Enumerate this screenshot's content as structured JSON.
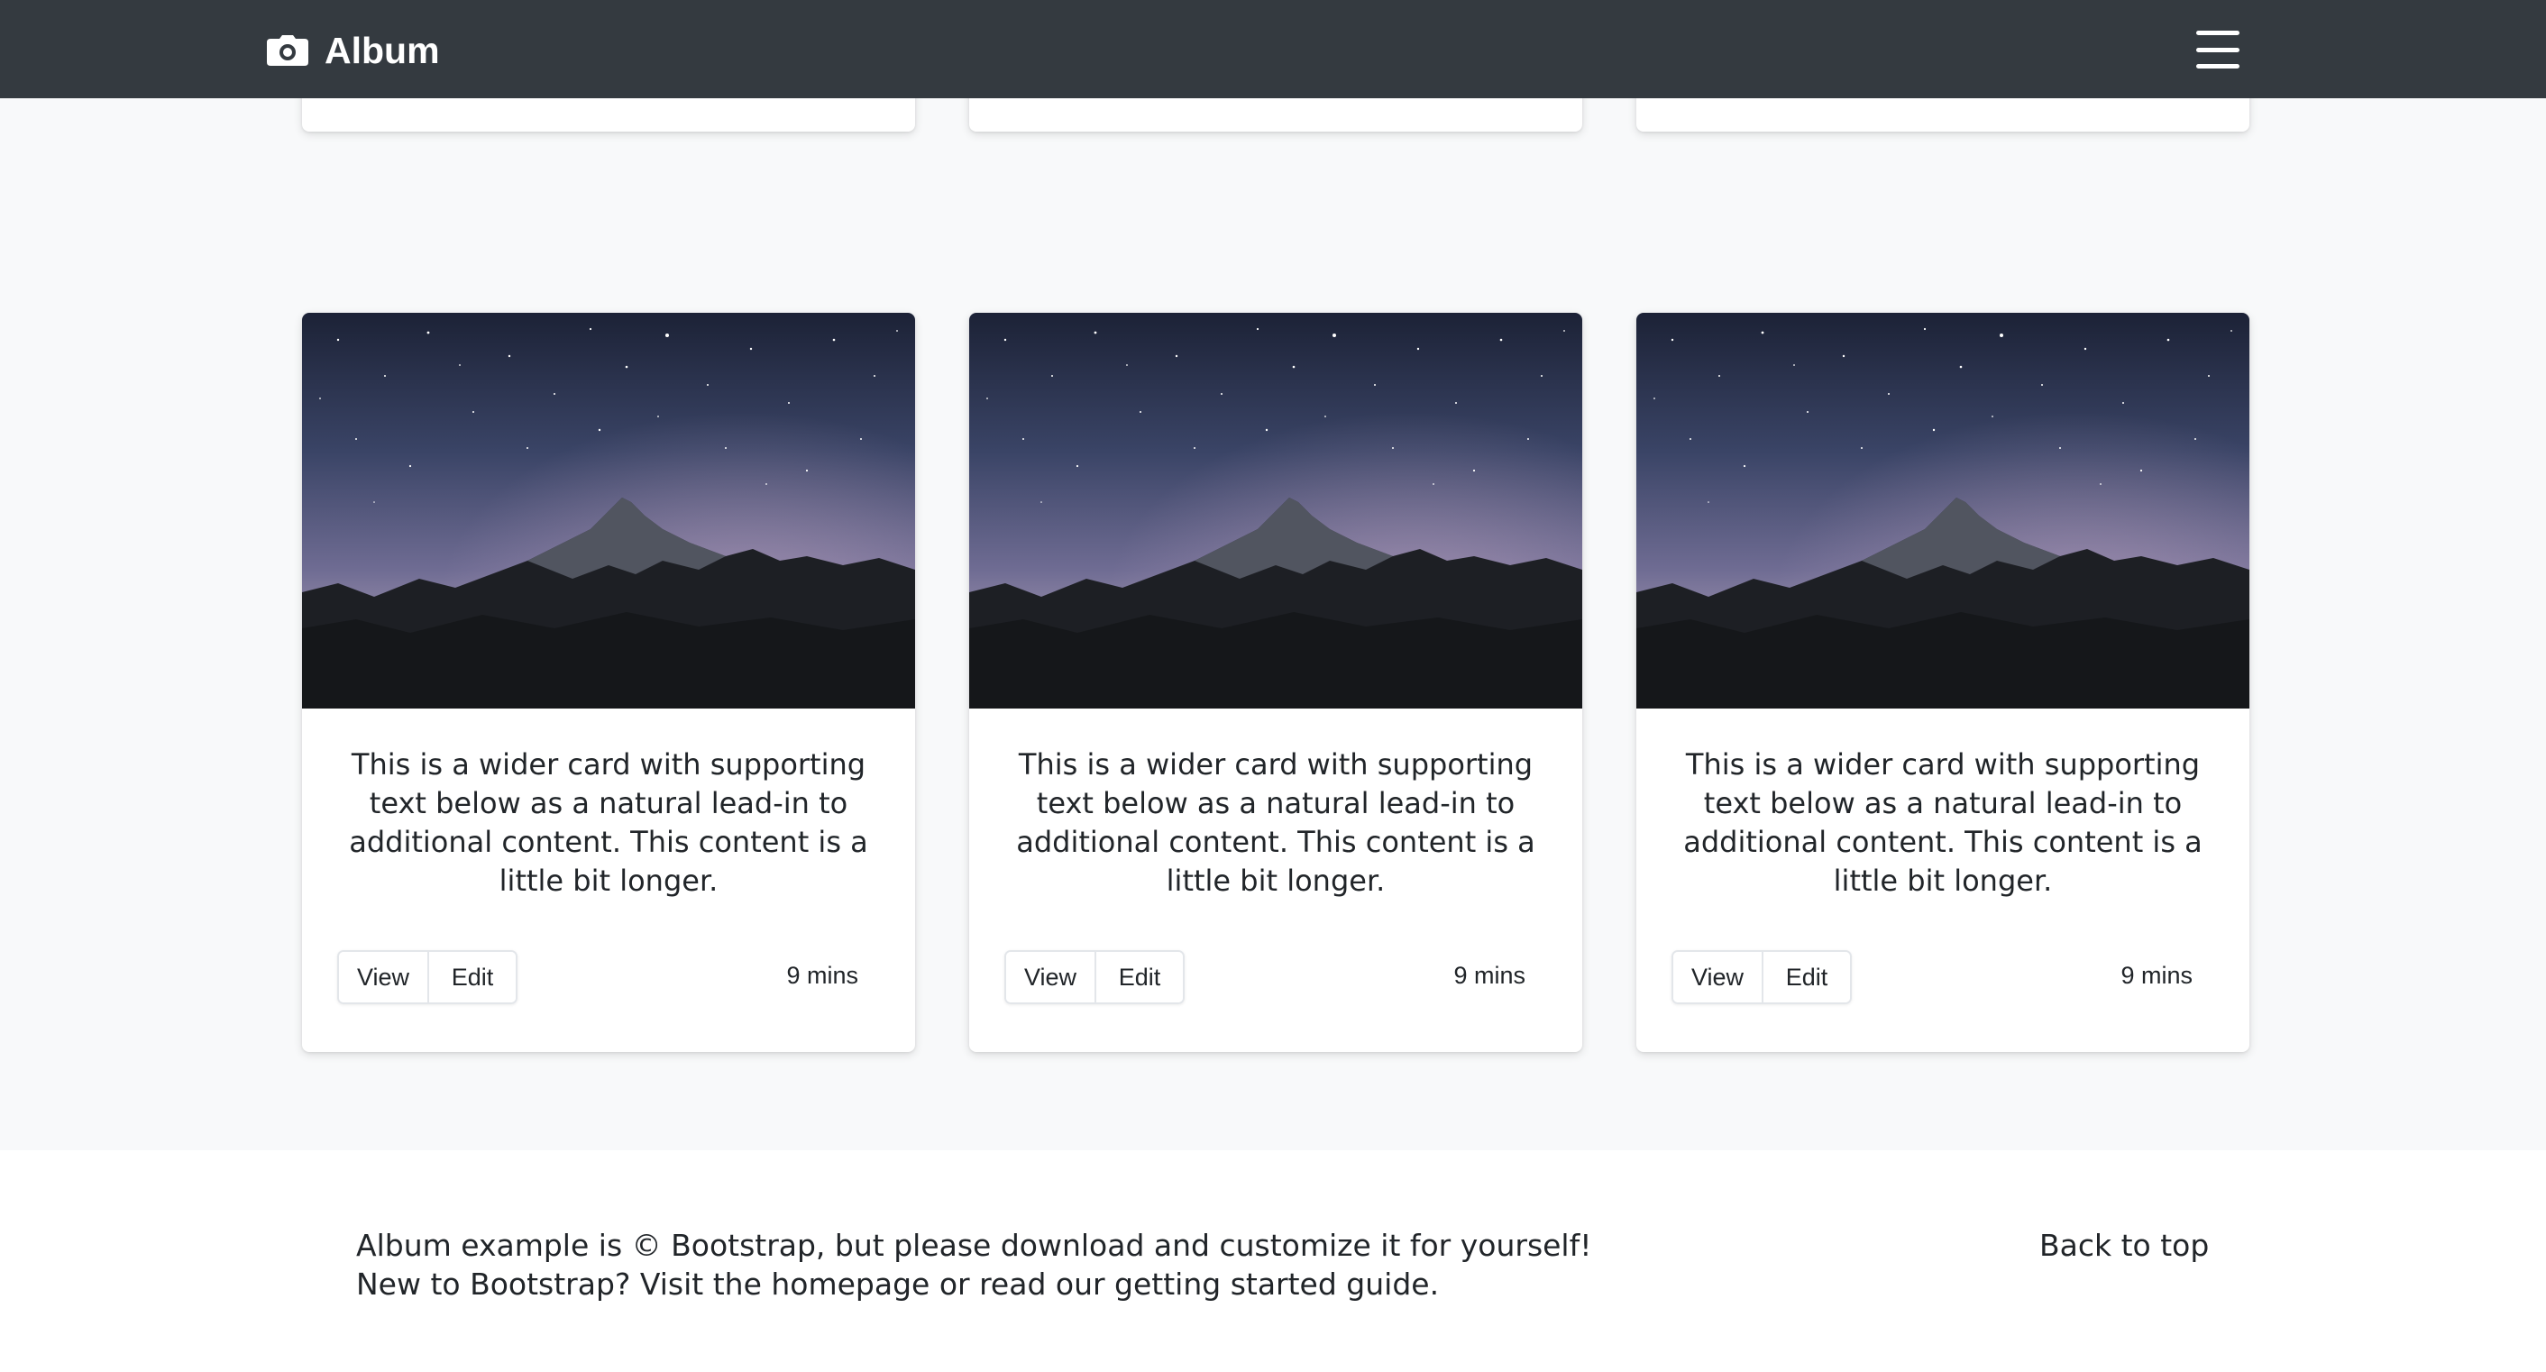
{
  "navbar": {
    "brand_label": "Album",
    "brand_icon": "camera-icon",
    "toggler_icon": "hamburger-menu-icon",
    "background": "#343a40"
  },
  "cards": [
    {
      "text": "This is a wider card with supporting text below as a natural lead-in to additional content. This content is a little bit longer.",
      "view_label": "View",
      "edit_label": "Edit",
      "time": "9 mins"
    },
    {
      "text": "This is a wider card with supporting text below as a natural lead-in to additional content. This content is a little bit longer.",
      "view_label": "View",
      "edit_label": "Edit",
      "time": "9 mins"
    },
    {
      "text": "This is a wider card with supporting text below as a natural lead-in to additional content. This content is a little bit longer.",
      "view_label": "View",
      "edit_label": "Edit",
      "time": "9 mins"
    }
  ],
  "footer": {
    "line1": "Album example is © Bootstrap, but please download and customize it for yourself!",
    "line2": "New to Bootstrap? Visit the homepage or read our getting started guide.",
    "back_to_top": "Back to top"
  }
}
